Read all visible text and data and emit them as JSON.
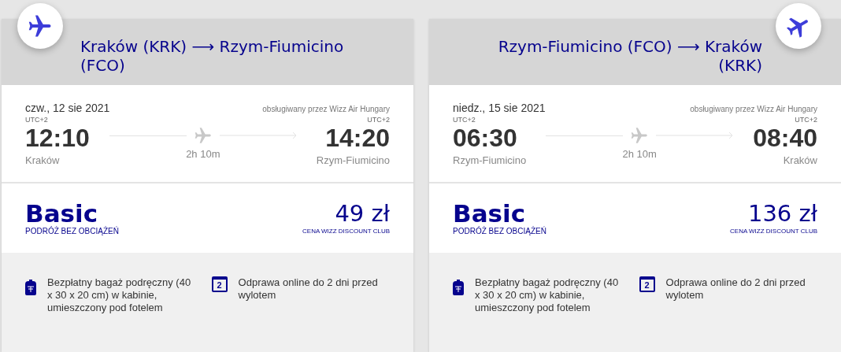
{
  "flights": [
    {
      "kind": "outbound",
      "title": "Kraków (KRK) ⟶ Rzym-Fiumicino (FCO)",
      "date": "czw., 12 sie 2021",
      "operator": "obsługiwany przez Wizz Air Hungary",
      "departure": {
        "tz": "UTC+2",
        "time": "12:10",
        "city": "Kraków"
      },
      "duration": "2h 10m",
      "arrival": {
        "tz": "UTC+2",
        "time": "14:20",
        "city": "Rzym-Fiumicino"
      },
      "fare": {
        "name": "Basic",
        "subtitle": "PODRÓŻ BEZ OBCIĄŻEŃ",
        "price": "49 zł",
        "price_note": "CENA WIZZ DISCOUNT CLUB"
      },
      "features": [
        {
          "kind": "bag",
          "text": "Bezpłatny bagaż podręczny (40 x 30 x 20 cm) w kabinie, umieszczony pod fotelem"
        },
        {
          "kind": "calendar",
          "icon_text": "2",
          "text": "Odprawa online do 2 dni przed wylotem"
        }
      ]
    },
    {
      "kind": "return",
      "title": "Rzym-Fiumicino (FCO) ⟶ Kraków (KRK)",
      "date": "niedz., 15 sie 2021",
      "operator": "obsługiwany przez Wizz Air Hungary",
      "departure": {
        "tz": "UTC+2",
        "time": "06:30",
        "city": "Rzym-Fiumicino"
      },
      "duration": "2h 10m",
      "arrival": {
        "tz": "UTC+2",
        "time": "08:40",
        "city": "Kraków"
      },
      "fare": {
        "name": "Basic",
        "subtitle": "PODRÓŻ BEZ OBCIĄŻEŃ",
        "price": "136 zł",
        "price_note": "CENA WIZZ DISCOUNT CLUB"
      },
      "features": [
        {
          "kind": "bag",
          "text": "Bezpłatny bagaż podręczny (40 x 30 x 20 cm) w kabinie, umieszczony pod fotelem"
        },
        {
          "kind": "calendar",
          "icon_text": "2",
          "text": "Odprawa online do 2 dni przed wylotem"
        }
      ]
    }
  ]
}
